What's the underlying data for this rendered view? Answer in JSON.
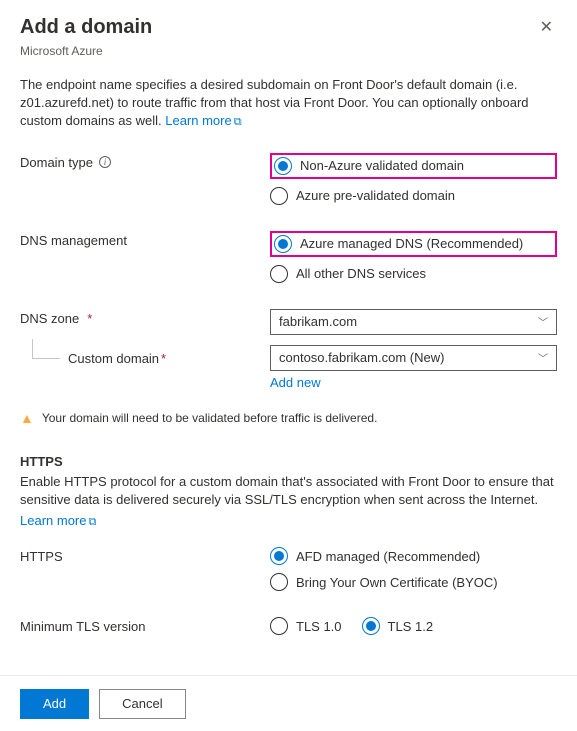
{
  "header": {
    "title": "Add a domain",
    "subtitle": "Microsoft Azure"
  },
  "description": {
    "text": "The endpoint name specifies a desired subdomain on Front Door's default domain (i.e. z01.azurefd.net) to route traffic from that host via Front Door. You can optionally onboard custom domains as well. ",
    "learn_more": "Learn more"
  },
  "domain_type": {
    "label": "Domain type",
    "opt1": "Non-Azure validated domain",
    "opt2": "Azure pre-validated domain"
  },
  "dns_mgmt": {
    "label": "DNS management",
    "opt1": "Azure managed DNS (Recommended)",
    "opt2": "All other DNS services"
  },
  "dns_zone": {
    "label": "DNS zone",
    "value": "fabrikam.com"
  },
  "custom_domain": {
    "label": "Custom domain",
    "value": "contoso.fabrikam.com (New)",
    "add_new": "Add new"
  },
  "warning": "Your domain will need to be validated before traffic is delivered.",
  "https": {
    "heading": "HTTPS",
    "desc": "Enable HTTPS protocol for a custom domain that's associated with Front Door to ensure that sensitive data is delivered securely via SSL/TLS encryption when sent across the Internet.",
    "learn_more": "Learn more",
    "label": "HTTPS",
    "opt1": "AFD managed (Recommended)",
    "opt2": "Bring Your Own Certificate (BYOC)"
  },
  "tls": {
    "label": "Minimum TLS version",
    "opt1": "TLS 1.0",
    "opt2": "TLS 1.2"
  },
  "footer": {
    "add": "Add",
    "cancel": "Cancel"
  }
}
